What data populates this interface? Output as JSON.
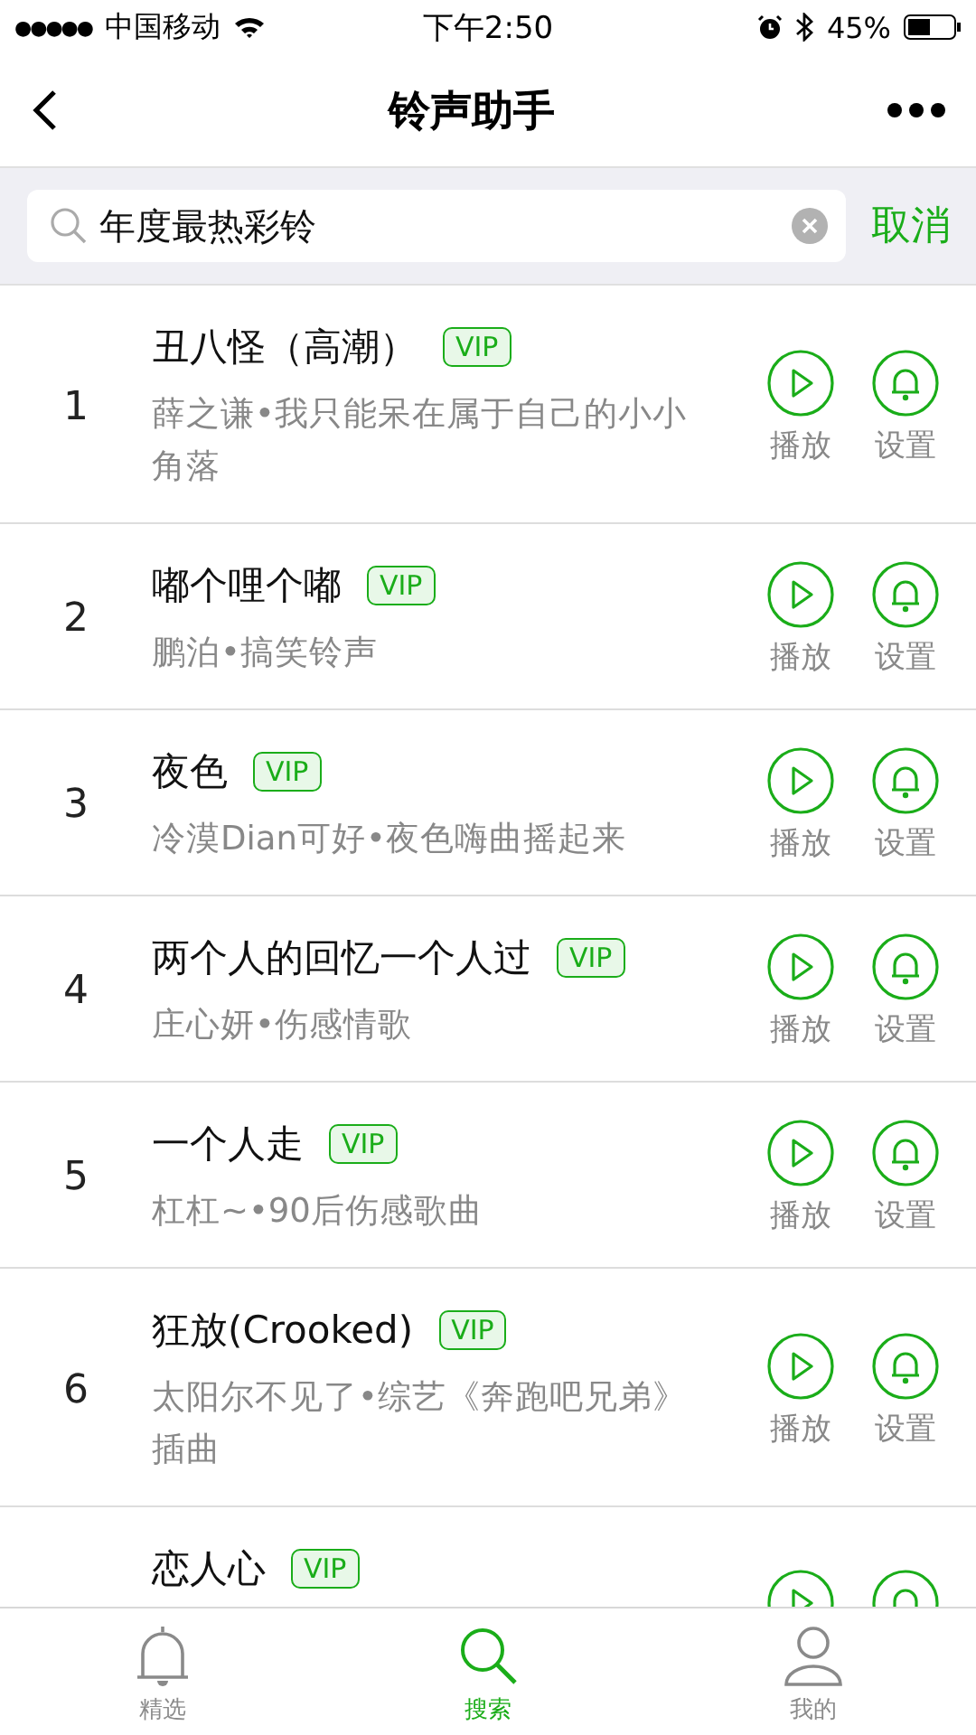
{
  "status_bar": {
    "signal_dots": "●●●●●",
    "carrier": "中国移动",
    "time": "下午2:50",
    "battery": "45%"
  },
  "nav": {
    "title": "铃声助手"
  },
  "search": {
    "value": "年度最热彩铃",
    "cancel": "取消"
  },
  "results": [
    {
      "rank": "1",
      "title": "丑八怪（高潮）",
      "badge": "VIP",
      "subtitle": "薛之谦•我只能呆在属于自己的小小角落",
      "play": "播放",
      "set": "设置"
    },
    {
      "rank": "2",
      "title": "嘟个哩个嘟",
      "badge": "VIP",
      "subtitle": "鹏泊•搞笑铃声",
      "play": "播放",
      "set": "设置"
    },
    {
      "rank": "3",
      "title": "夜色",
      "badge": "VIP",
      "subtitle": "冷漠Dian可好•夜色嗨曲摇起来",
      "play": "播放",
      "set": "设置"
    },
    {
      "rank": "4",
      "title": "两个人的回忆一个人过",
      "badge": "VIP",
      "subtitle": "庄心妍•伤感情歌",
      "play": "播放",
      "set": "设置"
    },
    {
      "rank": "5",
      "title": "一个人走",
      "badge": "VIP",
      "subtitle": "杠杠~•90后伤感歌曲",
      "play": "播放",
      "set": "设置"
    },
    {
      "rank": "6",
      "title": "狂放(Crooked)",
      "badge": "VIP",
      "subtitle": "太阳尔不见了•综艺《奔跑吧兄弟》插曲",
      "play": "播放",
      "set": "设置"
    },
    {
      "title": "恋人心",
      "badge": "VIP"
    }
  ],
  "tab_bar": [
    {
      "kind": "bell",
      "label": "精选",
      "selected": false
    },
    {
      "kind": "search",
      "label": "搜索",
      "selected": true
    },
    {
      "kind": "person",
      "label": "我的",
      "selected": false
    }
  ]
}
